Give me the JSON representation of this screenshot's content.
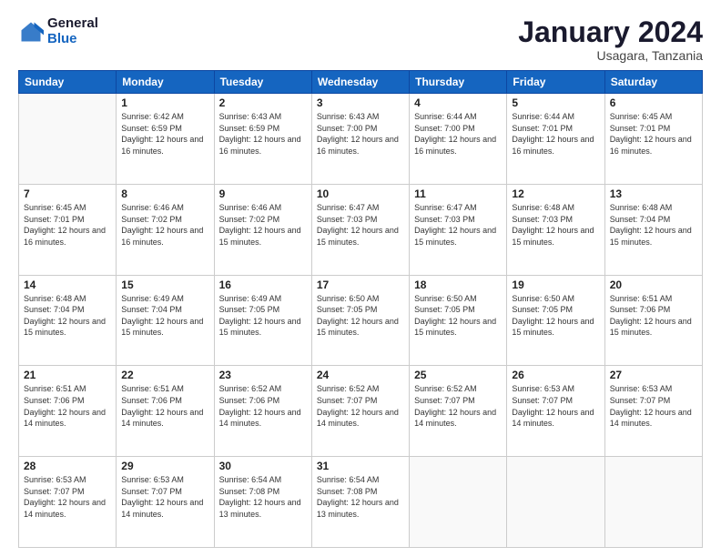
{
  "logo": {
    "general": "General",
    "blue": "Blue"
  },
  "header": {
    "month": "January 2024",
    "location": "Usagara, Tanzania"
  },
  "weekdays": [
    "Sunday",
    "Monday",
    "Tuesday",
    "Wednesday",
    "Thursday",
    "Friday",
    "Saturday"
  ],
  "weeks": [
    [
      {
        "day": "",
        "sunrise": "",
        "sunset": "",
        "daylight": ""
      },
      {
        "day": "1",
        "sunrise": "6:42 AM",
        "sunset": "6:59 PM",
        "daylight": "12 hours and 16 minutes."
      },
      {
        "day": "2",
        "sunrise": "6:43 AM",
        "sunset": "6:59 PM",
        "daylight": "12 hours and 16 minutes."
      },
      {
        "day": "3",
        "sunrise": "6:43 AM",
        "sunset": "7:00 PM",
        "daylight": "12 hours and 16 minutes."
      },
      {
        "day": "4",
        "sunrise": "6:44 AM",
        "sunset": "7:00 PM",
        "daylight": "12 hours and 16 minutes."
      },
      {
        "day": "5",
        "sunrise": "6:44 AM",
        "sunset": "7:01 PM",
        "daylight": "12 hours and 16 minutes."
      },
      {
        "day": "6",
        "sunrise": "6:45 AM",
        "sunset": "7:01 PM",
        "daylight": "12 hours and 16 minutes."
      }
    ],
    [
      {
        "day": "7",
        "sunrise": "6:45 AM",
        "sunset": "7:01 PM",
        "daylight": "12 hours and 16 minutes."
      },
      {
        "day": "8",
        "sunrise": "6:46 AM",
        "sunset": "7:02 PM",
        "daylight": "12 hours and 16 minutes."
      },
      {
        "day": "9",
        "sunrise": "6:46 AM",
        "sunset": "7:02 PM",
        "daylight": "12 hours and 15 minutes."
      },
      {
        "day": "10",
        "sunrise": "6:47 AM",
        "sunset": "7:03 PM",
        "daylight": "12 hours and 15 minutes."
      },
      {
        "day": "11",
        "sunrise": "6:47 AM",
        "sunset": "7:03 PM",
        "daylight": "12 hours and 15 minutes."
      },
      {
        "day": "12",
        "sunrise": "6:48 AM",
        "sunset": "7:03 PM",
        "daylight": "12 hours and 15 minutes."
      },
      {
        "day": "13",
        "sunrise": "6:48 AM",
        "sunset": "7:04 PM",
        "daylight": "12 hours and 15 minutes."
      }
    ],
    [
      {
        "day": "14",
        "sunrise": "6:48 AM",
        "sunset": "7:04 PM",
        "daylight": "12 hours and 15 minutes."
      },
      {
        "day": "15",
        "sunrise": "6:49 AM",
        "sunset": "7:04 PM",
        "daylight": "12 hours and 15 minutes."
      },
      {
        "day": "16",
        "sunrise": "6:49 AM",
        "sunset": "7:05 PM",
        "daylight": "12 hours and 15 minutes."
      },
      {
        "day": "17",
        "sunrise": "6:50 AM",
        "sunset": "7:05 PM",
        "daylight": "12 hours and 15 minutes."
      },
      {
        "day": "18",
        "sunrise": "6:50 AM",
        "sunset": "7:05 PM",
        "daylight": "12 hours and 15 minutes."
      },
      {
        "day": "19",
        "sunrise": "6:50 AM",
        "sunset": "7:05 PM",
        "daylight": "12 hours and 15 minutes."
      },
      {
        "day": "20",
        "sunrise": "6:51 AM",
        "sunset": "7:06 PM",
        "daylight": "12 hours and 15 minutes."
      }
    ],
    [
      {
        "day": "21",
        "sunrise": "6:51 AM",
        "sunset": "7:06 PM",
        "daylight": "12 hours and 14 minutes."
      },
      {
        "day": "22",
        "sunrise": "6:51 AM",
        "sunset": "7:06 PM",
        "daylight": "12 hours and 14 minutes."
      },
      {
        "day": "23",
        "sunrise": "6:52 AM",
        "sunset": "7:06 PM",
        "daylight": "12 hours and 14 minutes."
      },
      {
        "day": "24",
        "sunrise": "6:52 AM",
        "sunset": "7:07 PM",
        "daylight": "12 hours and 14 minutes."
      },
      {
        "day": "25",
        "sunrise": "6:52 AM",
        "sunset": "7:07 PM",
        "daylight": "12 hours and 14 minutes."
      },
      {
        "day": "26",
        "sunrise": "6:53 AM",
        "sunset": "7:07 PM",
        "daylight": "12 hours and 14 minutes."
      },
      {
        "day": "27",
        "sunrise": "6:53 AM",
        "sunset": "7:07 PM",
        "daylight": "12 hours and 14 minutes."
      }
    ],
    [
      {
        "day": "28",
        "sunrise": "6:53 AM",
        "sunset": "7:07 PM",
        "daylight": "12 hours and 14 minutes."
      },
      {
        "day": "29",
        "sunrise": "6:53 AM",
        "sunset": "7:07 PM",
        "daylight": "12 hours and 14 minutes."
      },
      {
        "day": "30",
        "sunrise": "6:54 AM",
        "sunset": "7:08 PM",
        "daylight": "12 hours and 13 minutes."
      },
      {
        "day": "31",
        "sunrise": "6:54 AM",
        "sunset": "7:08 PM",
        "daylight": "12 hours and 13 minutes."
      },
      {
        "day": "",
        "sunrise": "",
        "sunset": "",
        "daylight": ""
      },
      {
        "day": "",
        "sunrise": "",
        "sunset": "",
        "daylight": ""
      },
      {
        "day": "",
        "sunrise": "",
        "sunset": "",
        "daylight": ""
      }
    ]
  ]
}
